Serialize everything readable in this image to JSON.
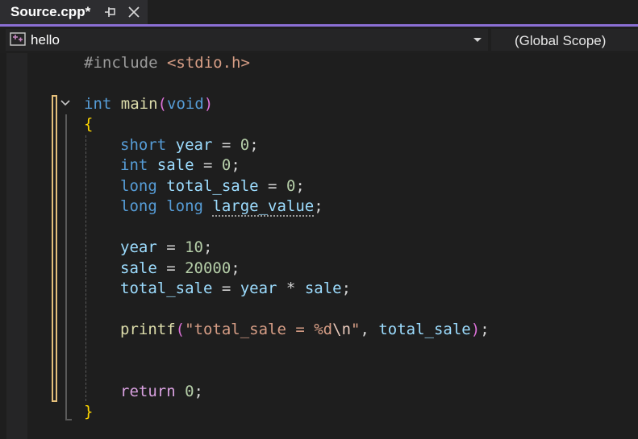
{
  "tab": {
    "title": "Source.cpp*"
  },
  "navbar": {
    "project": "hello",
    "scope": "(Global Scope)"
  },
  "code": {
    "l1": {
      "pp": "#include ",
      "hdr": "<stdio.h>"
    },
    "l3": {
      "kw": "int",
      "fn": "main",
      "p1": "(",
      "kw2": "void",
      "p2": ")"
    },
    "l4": {
      "brace": "{"
    },
    "l5": {
      "kw": "short",
      "var": "year",
      "op": " = ",
      "num": "0",
      "end": ";"
    },
    "l6": {
      "kw": "int",
      "var": "sale",
      "op": " = ",
      "num": "0",
      "end": ";"
    },
    "l7": {
      "kw": "long",
      "var": "total_sale",
      "op": " = ",
      "num": "0",
      "end": ";"
    },
    "l8": {
      "kw": "long long",
      "var": "large_value",
      "end": ";"
    },
    "l10": {
      "var": "year",
      "op": " = ",
      "num": "10",
      "end": ";"
    },
    "l11": {
      "var": "sale",
      "op": " = ",
      "num": "20000",
      "end": ";"
    },
    "l12": {
      "var": "total_sale",
      "op": " = ",
      "var2": "year",
      "op2": " * ",
      "var3": "sale",
      "end": ";"
    },
    "l14": {
      "fn": "printf",
      "p1": "(",
      "str1": "\"total_sale = %d",
      "esc": "\\n",
      "str2": "\"",
      "comma": ", ",
      "var": "total_sale",
      "p2": ")",
      "end": ";"
    },
    "l17": {
      "ctl": "return",
      "num": "0",
      "end": ";"
    },
    "l18": {
      "brace": "}"
    }
  },
  "colors": {
    "accent": "#8b6fd4",
    "keyword": "#569cd6",
    "function": "#dcdcaa",
    "variable": "#9cdcfe",
    "number": "#b5cea8",
    "string": "#d69d85",
    "control": "#d8a0df",
    "brace": "#ffd700",
    "change_marker": "#e5c07b"
  },
  "icons": {
    "pin": "pin-icon",
    "close": "close-icon",
    "project": "project-icon",
    "fold": "chevron-down-icon"
  }
}
